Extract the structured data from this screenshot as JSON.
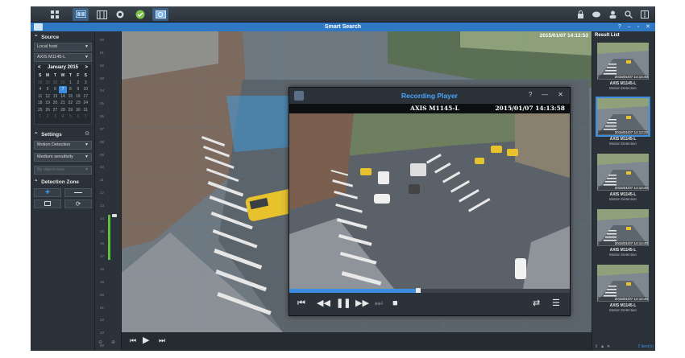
{
  "window": {
    "title": "Smart Search"
  },
  "taskbar": {
    "apps": [
      "main-menu-icon",
      "monitor-center-icon",
      "timeline-icon",
      "camera-icon",
      "status-icon",
      "smart-search-icon"
    ]
  },
  "left": {
    "source_label": "Source",
    "host": "Local host",
    "camera": "AXIS M1145-L",
    "calendar": {
      "month": "January 2015",
      "dow": [
        "S",
        "M",
        "T",
        "W",
        "T",
        "F",
        "S"
      ],
      "days": [
        "28",
        "29",
        "30",
        "31",
        "1",
        "2",
        "3",
        "4",
        "5",
        "6",
        "7",
        "8",
        "9",
        "10",
        "11",
        "12",
        "13",
        "14",
        "15",
        "16",
        "17",
        "18",
        "19",
        "20",
        "21",
        "22",
        "23",
        "24",
        "25",
        "26",
        "27",
        "28",
        "29",
        "30",
        "31",
        "1",
        "2",
        "3",
        "4",
        "5",
        "6",
        "7"
      ],
      "selected": "7"
    },
    "settings_label": "Settings",
    "mode": "Motion Detection",
    "sensitivity": "Medium sensitivity",
    "object_size": "By object size",
    "zone_label": "Detection Zone"
  },
  "timeline": {
    "ticks": [
      "00",
      "01",
      "02",
      "03",
      "04",
      "05",
      "06",
      "07",
      "08",
      "09",
      "10",
      "11",
      "12",
      "13",
      "14",
      "15",
      "16",
      "17",
      "18",
      "19",
      "20",
      "21",
      "22",
      "23",
      "00"
    ]
  },
  "main": {
    "timestamp": "2015/01/07 14:12:53"
  },
  "results": {
    "header": "Result List",
    "items": [
      {
        "stamp": "2015/01/07 14:14:40",
        "camera": "AXIS M1145-L",
        "event": "Motion Detection"
      },
      {
        "stamp": "2015/01/07 14:13:22",
        "camera": "AXIS M1145-L",
        "event": "Motion Detection"
      },
      {
        "stamp": "2015/01/07 14:14:40",
        "camera": "AXIS M1145-L",
        "event": "Motion Detection"
      },
      {
        "stamp": "2015/01/07 14:14:40",
        "camera": "AXIS M1145-L",
        "event": "Motion Detection"
      },
      {
        "stamp": "2015/01/07 14:14:40",
        "camera": "AXIS M1145-L",
        "event": "Motion Detection"
      }
    ],
    "count": "2 item(s)",
    "active_index": 1
  },
  "player": {
    "title": "Recording Player",
    "camera": "AXIS M1145-L",
    "timestamp": "2015/01/07 14:13:58",
    "progress": 0.46
  },
  "colors": {
    "accent": "#3c8fe0",
    "title_bar": "#2f78c4",
    "timeline_recording": "#5fbf3f"
  }
}
